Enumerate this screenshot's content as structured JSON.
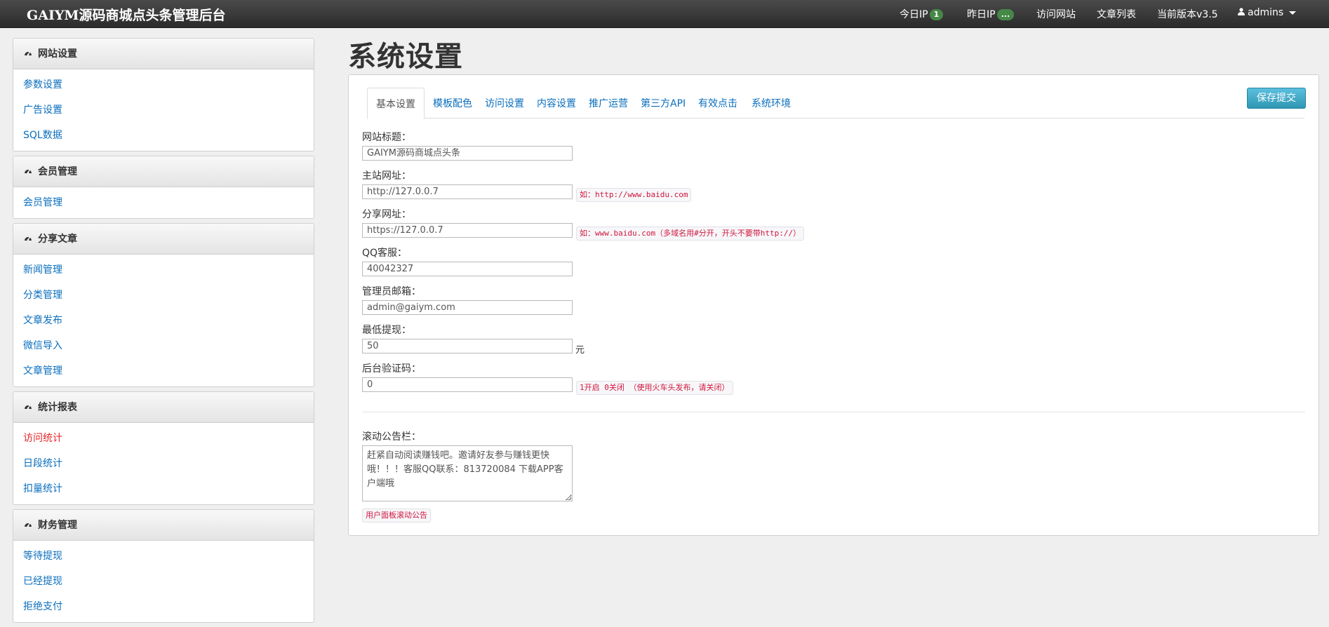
{
  "navbar": {
    "brand": "GAIYM源码商城点头条管理后台",
    "today_ip_label": "今日IP",
    "today_ip_count": "1",
    "yesterday_ip_label": "昨日IP",
    "yesterday_ip_count": "...",
    "visit_site": "访问网站",
    "article_list": "文章列表",
    "version": "当前版本v3.5",
    "user": "admins"
  },
  "sidebar": {
    "panels": [
      {
        "title": "网站设置",
        "items": [
          "参数设置",
          "广告设置",
          "SQL数据"
        ]
      },
      {
        "title": "会员管理",
        "items": [
          "会员管理"
        ]
      },
      {
        "title": "分享文章",
        "items": [
          "新闻管理",
          "分类管理",
          "文章发布",
          "微信导入",
          "文章管理"
        ]
      },
      {
        "title": "统计报表",
        "items": [
          "访问统计",
          "日段统计",
          "扣量统计"
        ]
      },
      {
        "title": "财务管理",
        "items": [
          "等待提现",
          "已经提现",
          "拒绝支付"
        ]
      }
    ],
    "active_item": "访问统计"
  },
  "main": {
    "page_title": "系统设置",
    "tabs": [
      "基本设置",
      "模板配色",
      "访问设置",
      "内容设置",
      "推广运营",
      "第三方API",
      "有效点击",
      "系统环境"
    ],
    "active_tab": "基本设置",
    "save_button": "保存提交",
    "fields": {
      "site_title": {
        "label": "网站标题：",
        "value": "GAIYM源码商城点头条"
      },
      "main_url": {
        "label": "主站网址：",
        "value": "http://127.0.0.7",
        "hint": "如：http://www.baidu.com"
      },
      "share_url": {
        "label": "分享网址：",
        "value": "https://127.0.0.7",
        "hint": "如：www.baidu.com（多域名用#分开，开头不要带http://）"
      },
      "qq_service": {
        "label": "QQ客服：",
        "value": "40042327"
      },
      "admin_email": {
        "label": "管理员邮箱：",
        "value": "admin@gaiym.com"
      },
      "min_withdraw": {
        "label": "最低提现：",
        "value": "50",
        "unit": "元"
      },
      "captcha": {
        "label": "后台验证码：",
        "value": "0",
        "hint": "1开启 0关闭 （使用火车头发布，请关闭）"
      },
      "notice": {
        "label": "滚动公告栏：",
        "value": "赶紧自动阅读赚钱吧。邀请好友参与赚钱更快哦！！！客服QQ联系：813720084  下载APP客户端哦",
        "hint": "用户面板滚动公告"
      }
    }
  }
}
